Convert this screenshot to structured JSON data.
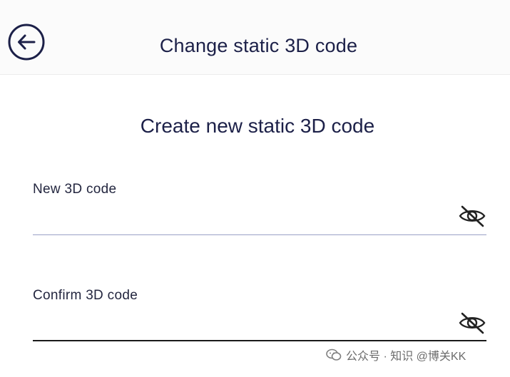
{
  "header": {
    "title": "Change static 3D code",
    "back_icon": "arrow-left-circle-icon"
  },
  "form": {
    "section_title": "Create new static 3D code",
    "new_code": {
      "label": "New 3D code",
      "value": "",
      "toggle_icon": "eye-slash-icon"
    },
    "confirm_code": {
      "label": "Confirm 3D code",
      "value": "",
      "toggle_icon": "eye-slash-icon"
    }
  },
  "watermark": {
    "text": "公众号 · 知识 @博关KK",
    "icon": "wechat-icon"
  },
  "colors": {
    "text": "#1c2048",
    "underline_idle": "#9aa0c6",
    "underline_focus": "#1a1a1a",
    "header_bg": "#fbfbfb"
  }
}
